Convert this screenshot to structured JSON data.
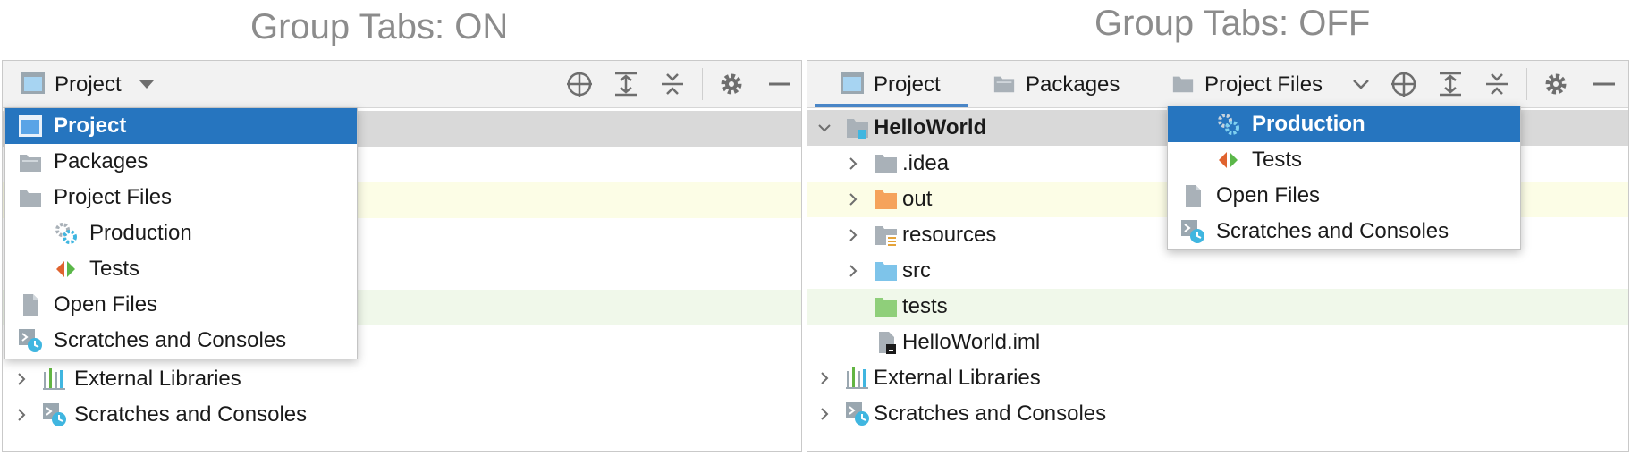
{
  "left": {
    "caption": "Group Tabs: ON",
    "toolbar": {
      "view_label": "Project"
    },
    "popup_items": [
      "Project",
      "Packages",
      "Project Files",
      "Production",
      "Tests",
      "Open Files",
      "Scratches and Consoles"
    ],
    "tree_visible": [
      "External Libraries",
      "Scratches and Consoles"
    ]
  },
  "right": {
    "caption": "Group Tabs: OFF",
    "tabs": [
      "Project",
      "Packages",
      "Project Files"
    ],
    "tree": {
      "root": "HelloWorld",
      "children": [
        ".idea",
        "out",
        "resources",
        "src",
        "tests",
        "HelloWorld.iml"
      ],
      "bottom": [
        "External Libraries",
        "Scratches and Consoles"
      ]
    },
    "popup_items": [
      "Production",
      "Tests",
      "Open Files",
      "Scratches and Consoles"
    ]
  },
  "colors": {
    "selection": "#2675bf",
    "caption": "#8c8c8c",
    "folder": "#a9b1b8",
    "folder_orange": "#f5a35c",
    "folder_blue": "#7ec4ea",
    "folder_green": "#8fcf7a",
    "tests_red": "#e0632f",
    "tests_green": "#5bb749",
    "highlight_yellow": "#fcfde6",
    "highlight_green": "#f0f8ea",
    "header_gray": "#d9d9d9"
  },
  "icons": [
    "project-view-icon",
    "dropdown-arrow-icon",
    "locate-icon",
    "expand-all-icon",
    "collapse-all-icon",
    "gear-icon",
    "minimize-icon",
    "packages-icon",
    "folder-icon",
    "production-gear-icon",
    "tests-icon",
    "open-files-icon",
    "scratches-icon",
    "libraries-icon",
    "module-icon",
    "iml-file-icon"
  ]
}
